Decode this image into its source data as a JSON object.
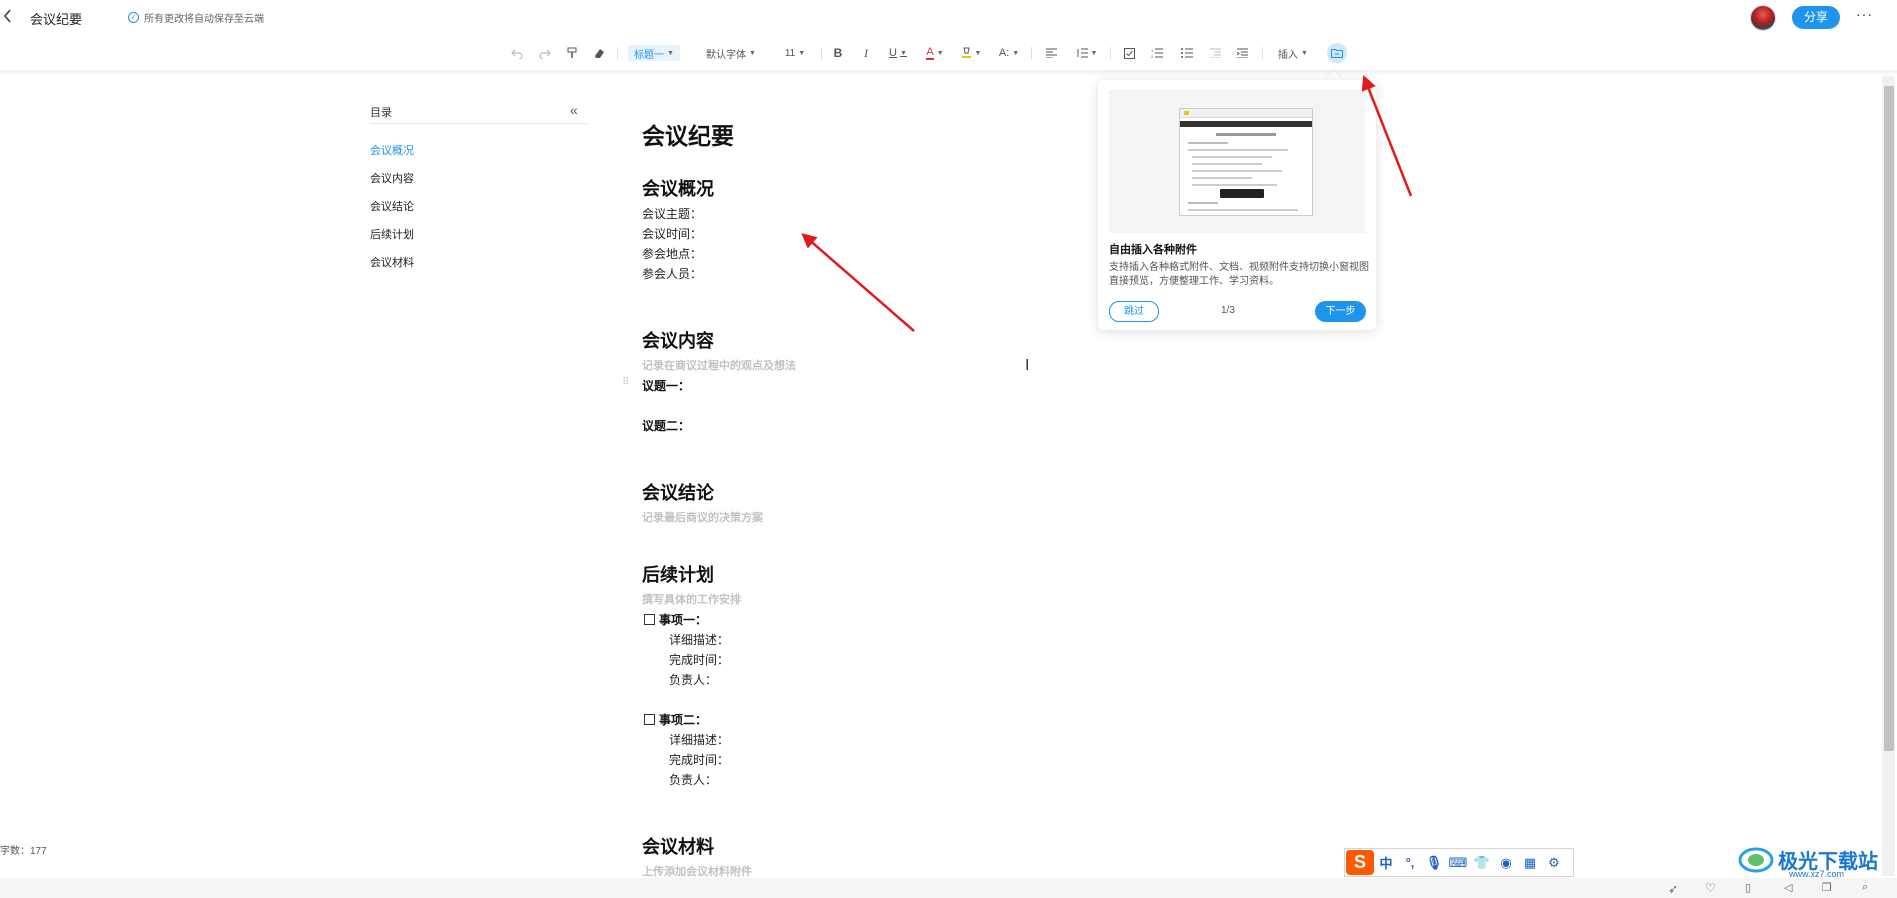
{
  "titlebar": {
    "back_icon": "chevron-left-icon",
    "title": "会议纪要",
    "save_status": "所有更改将自动保存至云端",
    "share_label": "分享",
    "more_label": "···"
  },
  "toolbar": {
    "heading_style": "标题一",
    "font_family": "默认字体",
    "font_size": "11",
    "insert_label": "插入",
    "accent_color": "#1e94ec"
  },
  "outline": {
    "title": "目录",
    "collapse_icon": "double-chevron-left-icon",
    "items": [
      {
        "label": "会议概况",
        "active": true
      },
      {
        "label": "会议内容",
        "active": false
      },
      {
        "label": "会议结论",
        "active": false
      },
      {
        "label": "后续计划",
        "active": false
      },
      {
        "label": "会议材料",
        "active": false
      }
    ]
  },
  "document": {
    "title": "会议纪要",
    "overview": {
      "heading": "会议概况",
      "fields": [
        "会议主题：",
        "会议时间：",
        "参会地点：",
        "参会人员："
      ]
    },
    "content": {
      "heading": "会议内容",
      "placeholder": "记录在商议过程中的观点及想法",
      "topics": [
        "议题一：",
        "议题二："
      ]
    },
    "conclusion": {
      "heading": "会议结论",
      "placeholder": "记录最后商议的决策方案"
    },
    "plan": {
      "heading": "后续计划",
      "placeholder": "撰写具体的工作安排",
      "items": [
        {
          "title": "事项一：",
          "fields": [
            "详细描述：",
            "完成时间：",
            "负责人："
          ]
        },
        {
          "title": "事项二：",
          "fields": [
            "详细描述：",
            "完成时间：",
            "负责人："
          ]
        }
      ]
    },
    "materials": {
      "heading": "会议材料",
      "placeholder": "上传添加会议材料附件"
    }
  },
  "popup": {
    "title": "自由插入各种附件",
    "description": "支持插入各种格式附件、文档、视频附件支持切换小窗视图直接预览，方便整理工作、学习资料。",
    "skip_label": "跳过",
    "page_indicator": "1/3",
    "next_label": "下一步"
  },
  "statusbar": {
    "word_count": "字数：177"
  },
  "ime": {
    "keys": [
      "中",
      "°,",
      "mic-icon",
      "keyboard-icon",
      "shirt-icon",
      "robot-icon",
      "grid-icon",
      "gear-icon"
    ]
  },
  "watermark": {
    "text": "极光下载站",
    "url": "www.xz7.com"
  }
}
